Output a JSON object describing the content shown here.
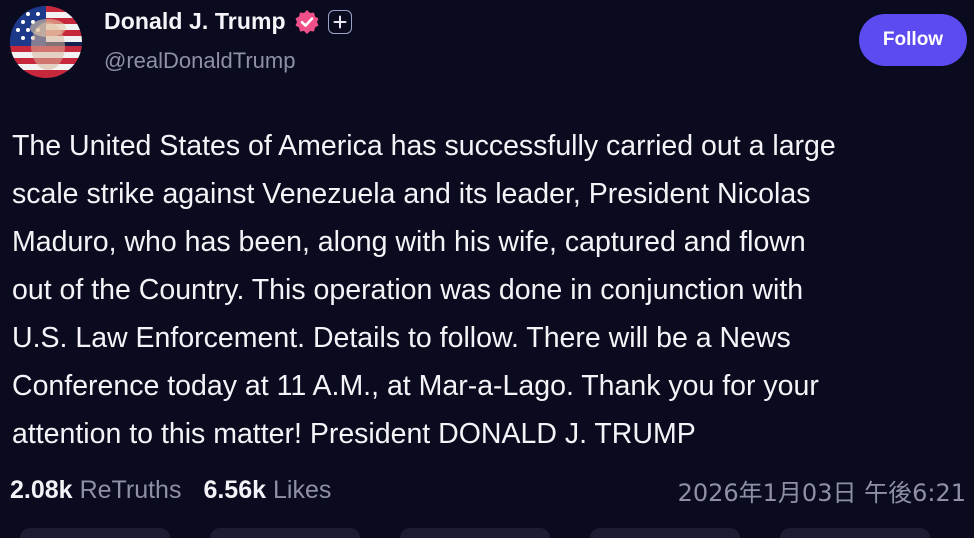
{
  "account": {
    "display_name": "Donald J. Trump",
    "handle": "@realDonaldTrump",
    "verified_color": "#f0508a"
  },
  "actions": {
    "follow_label": "Follow",
    "accent_color": "#5b4bf0"
  },
  "post": {
    "lines": [
      "The United States of America has successfully carried out a large",
      "scale strike against Venezuela and its leader, President Nicolas",
      "Maduro, who has been, along with his wife, captured and flown",
      "out of the Country. This operation was done in conjunction with",
      "U.S. Law Enforcement. Details to follow. There will be a News",
      "Conference today at 11 A.M., at Mar-a-Lago. Thank you for your",
      "attention to this matter! President DONALD J. TRUMP"
    ]
  },
  "stats": {
    "retruths_count": "2.08k",
    "retruths_label": "ReTruths",
    "likes_count": "6.56k",
    "likes_label": "Likes"
  },
  "timestamp": "2026年1月03日 午後6:21",
  "icons": {
    "avatar": "avatar-image",
    "verified": "verified-badge-icon",
    "plus": "plus-badge-icon"
  }
}
